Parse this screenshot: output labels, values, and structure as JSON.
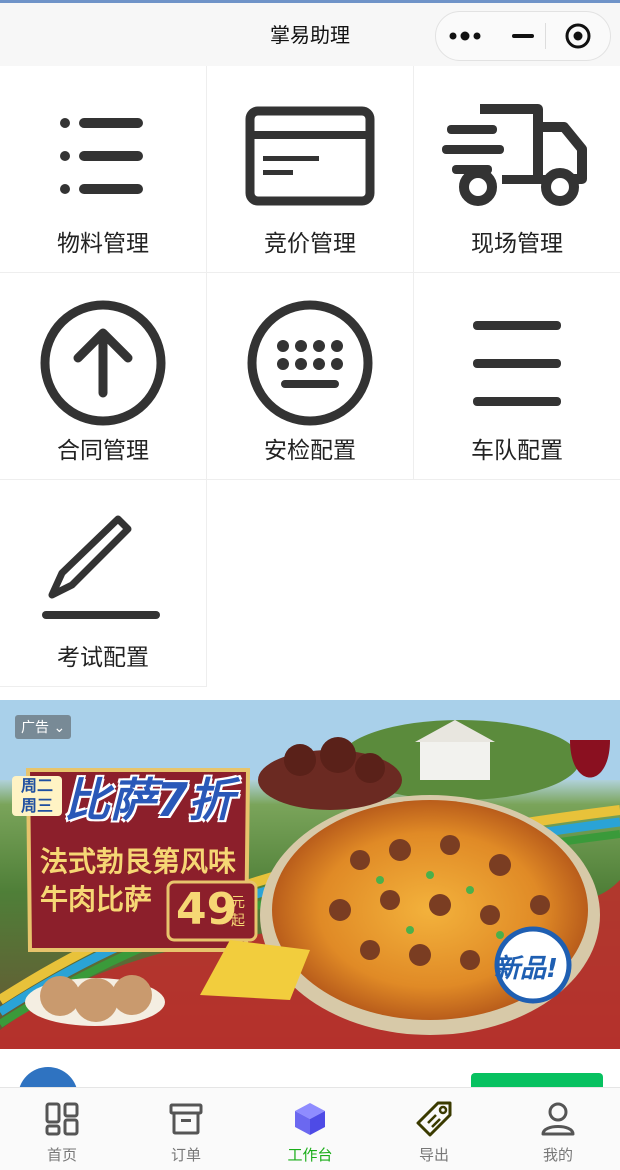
{
  "app": {
    "title": "掌易助理"
  },
  "capsule": {
    "more_icon": "more-dots-icon",
    "minimize_icon": "minimize-icon",
    "close_icon": "target-icon"
  },
  "grid": {
    "items": [
      {
        "label": "物料管理",
        "icon": "list-icon"
      },
      {
        "label": "竞价管理",
        "icon": "card-icon"
      },
      {
        "label": "现场管理",
        "icon": "truck-icon"
      },
      {
        "label": "合同管理",
        "icon": "arrow-up-circle-icon"
      },
      {
        "label": "安检配置",
        "icon": "keyboard-icon"
      },
      {
        "label": "车队配置",
        "icon": "menu-icon"
      },
      {
        "label": "考试配置",
        "icon": "edit-pen-icon"
      }
    ]
  },
  "ad": {
    "tag": "广告",
    "promo_days": "周二 周三",
    "headline": "比萨7折",
    "product_line1": "法式勃艮第风味",
    "product_line2": "牛肉比萨",
    "price": "49",
    "price_unit": "元起",
    "badge": "新品!"
  },
  "tabbar": {
    "items": [
      {
        "label": "首页",
        "icon": "home-grid-icon"
      },
      {
        "label": "订单",
        "icon": "archive-box-icon"
      },
      {
        "label": "工作台",
        "icon": "cube-icon"
      },
      {
        "label": "导出",
        "icon": "tag-icon"
      },
      {
        "label": "我的",
        "icon": "user-icon"
      }
    ],
    "active": "工作台",
    "active_color": "#1aad19"
  }
}
